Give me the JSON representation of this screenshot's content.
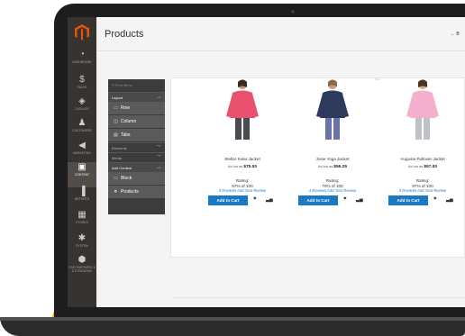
{
  "header": {
    "title": "Products",
    "back_label": "← B"
  },
  "sidebar": {
    "items": [
      {
        "label": "Dashboard",
        "icon": "gauge-icon"
      },
      {
        "label": "Sales",
        "icon": "dollar-icon"
      },
      {
        "label": "Catalog",
        "icon": "cube-icon"
      },
      {
        "label": "Customers",
        "icon": "person-icon"
      },
      {
        "label": "Marketing",
        "icon": "megaphone-icon"
      },
      {
        "label": "Content",
        "icon": "layout-icon",
        "active": true
      },
      {
        "label": "Reports",
        "icon": "bar-chart-icon"
      },
      {
        "label": "Stores",
        "icon": "store-icon"
      },
      {
        "label": "System",
        "icon": "gear-icon"
      },
      {
        "label": "Find Partners & Extensions",
        "icon": "cube-stack-icon"
      }
    ]
  },
  "builder": {
    "search_placeholder": "Find Items",
    "sections": {
      "layout": "Layout",
      "elements": "Elements",
      "media": "Media",
      "add_content": "Add Content"
    },
    "items": {
      "row": "Row",
      "column": "Column",
      "tabs": "Tabs",
      "block": "Block",
      "products": "Products"
    }
  },
  "canvas": {
    "tag": "Row"
  },
  "products": [
    {
      "name": "Stellar Solar Jacket",
      "price_prefix": "As low as",
      "price": "$75.00",
      "rating_label": "Rating:",
      "rating_value": "67% of 100",
      "reviews": "3  Reviews Add Your Review",
      "cart_label": "Add to Cart",
      "color": "#e8506e"
    },
    {
      "name": "Josie Yoga Jacket",
      "price_prefix": "As low as",
      "price": "$56.25",
      "rating_label": "Rating:",
      "rating_value": "70% of 100",
      "reviews": "4  Reviews Add Your Review",
      "cart_label": "Add to Cart",
      "color": "#2d3a5c"
    },
    {
      "name": "Augusta Pullover Jacket",
      "price_prefix": "As low as",
      "price": "$57.00",
      "rating_label": "Rating:",
      "rating_value": "87% of 100",
      "reviews": "3  Reviews Add Your Review",
      "cart_label": "Add to Cart",
      "color": "#f4b0cc"
    }
  ],
  "colors": {
    "accent": "#1979c3",
    "sidebar": "#373330",
    "brand": "#eb5202"
  }
}
